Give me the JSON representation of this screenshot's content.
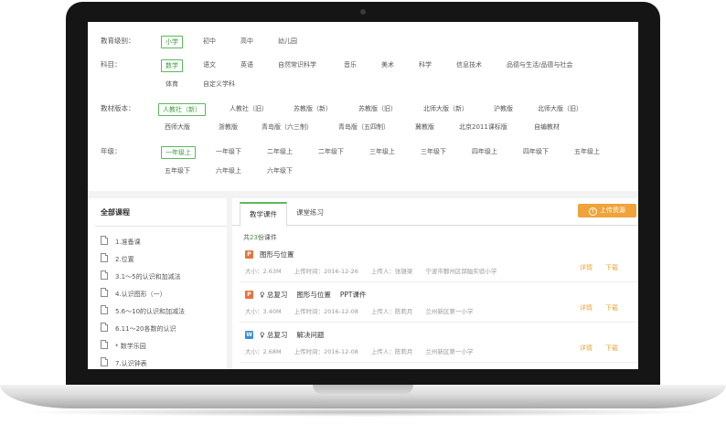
{
  "filters": [
    {
      "label": "教育级别：",
      "options": [
        "小学",
        "初中",
        "高中",
        "幼儿园"
      ],
      "selected": 0
    },
    {
      "label": "科目：",
      "options": [
        "数学",
        "语文",
        "英语",
        "自然常识科学",
        "音乐",
        "美术",
        "科学",
        "信息技术",
        "品德与生活/品德与社会",
        "体育",
        "自定义学科"
      ],
      "selected": 0
    },
    {
      "label": "教材版本：",
      "options": [
        "人教社（新）",
        "人教社（旧）",
        "苏教版（新）",
        "苏教版（旧）",
        "北师大版（新）",
        "沪教版",
        "北师大版（旧）",
        "西师大版",
        "浙教版",
        "青岛版（六三制）",
        "青岛版（五四制）",
        "冀教版",
        "北京2011课标版",
        "自编教材"
      ],
      "selected": 0
    },
    {
      "label": "年级：",
      "options": [
        "一年级上",
        "一年级下",
        "二年级上",
        "二年级下",
        "三年级上",
        "三年级下",
        "四年级上",
        "四年级下",
        "五年级上",
        "五年级下",
        "六年级上",
        "六年级下"
      ],
      "selected": 0
    }
  ],
  "sidebar": {
    "title": "全部课程",
    "items": [
      "1.准备课",
      "2.位置",
      "3.1～5的认识和加减法",
      "4.认识图形（一）",
      "5.6～10的认识和加减法",
      "6.11～20各数的认识",
      "* 数学乐园",
      "7.认识钟表"
    ]
  },
  "tabs": [
    "教学课件",
    "课堂练习"
  ],
  "upload_label": "上传资源",
  "count": {
    "prefix": "共",
    "number": "23",
    "suffix": "份课件"
  },
  "items": [
    {
      "badge": "P",
      "type": "ppt",
      "title_parts": [
        "图形与位置"
      ],
      "size": "大小：2.63M",
      "time": "上传时间：2016-12-26",
      "uploader": "上传人：张雄梁",
      "school": "宁波市鄞州区邱隘实验小学",
      "detail": "详情",
      "download": "下载"
    },
    {
      "badge": "P",
      "type": "ppt",
      "title_parts": [
        "♀ 总复习",
        "图形与位置",
        "PPT课件"
      ],
      "size": "大小：3.40M",
      "time": "上传时间：2016-12-08",
      "uploader": "上传人：陈莉月",
      "school": "兰州新区第一小学",
      "detail": "详情",
      "download": "下载"
    },
    {
      "badge": "W",
      "type": "word",
      "title_parts": [
        "♀ 总复习",
        "解决问题"
      ],
      "size": "大小：2.68M",
      "time": "上传时间：2016-12-08",
      "uploader": "上传人：陈莉月",
      "school": "兰州新区第一小学",
      "detail": "详情",
      "download": "下载"
    }
  ],
  "colors": {
    "accent_green": "#5cb85c",
    "accent_orange": "#f0a33a"
  }
}
